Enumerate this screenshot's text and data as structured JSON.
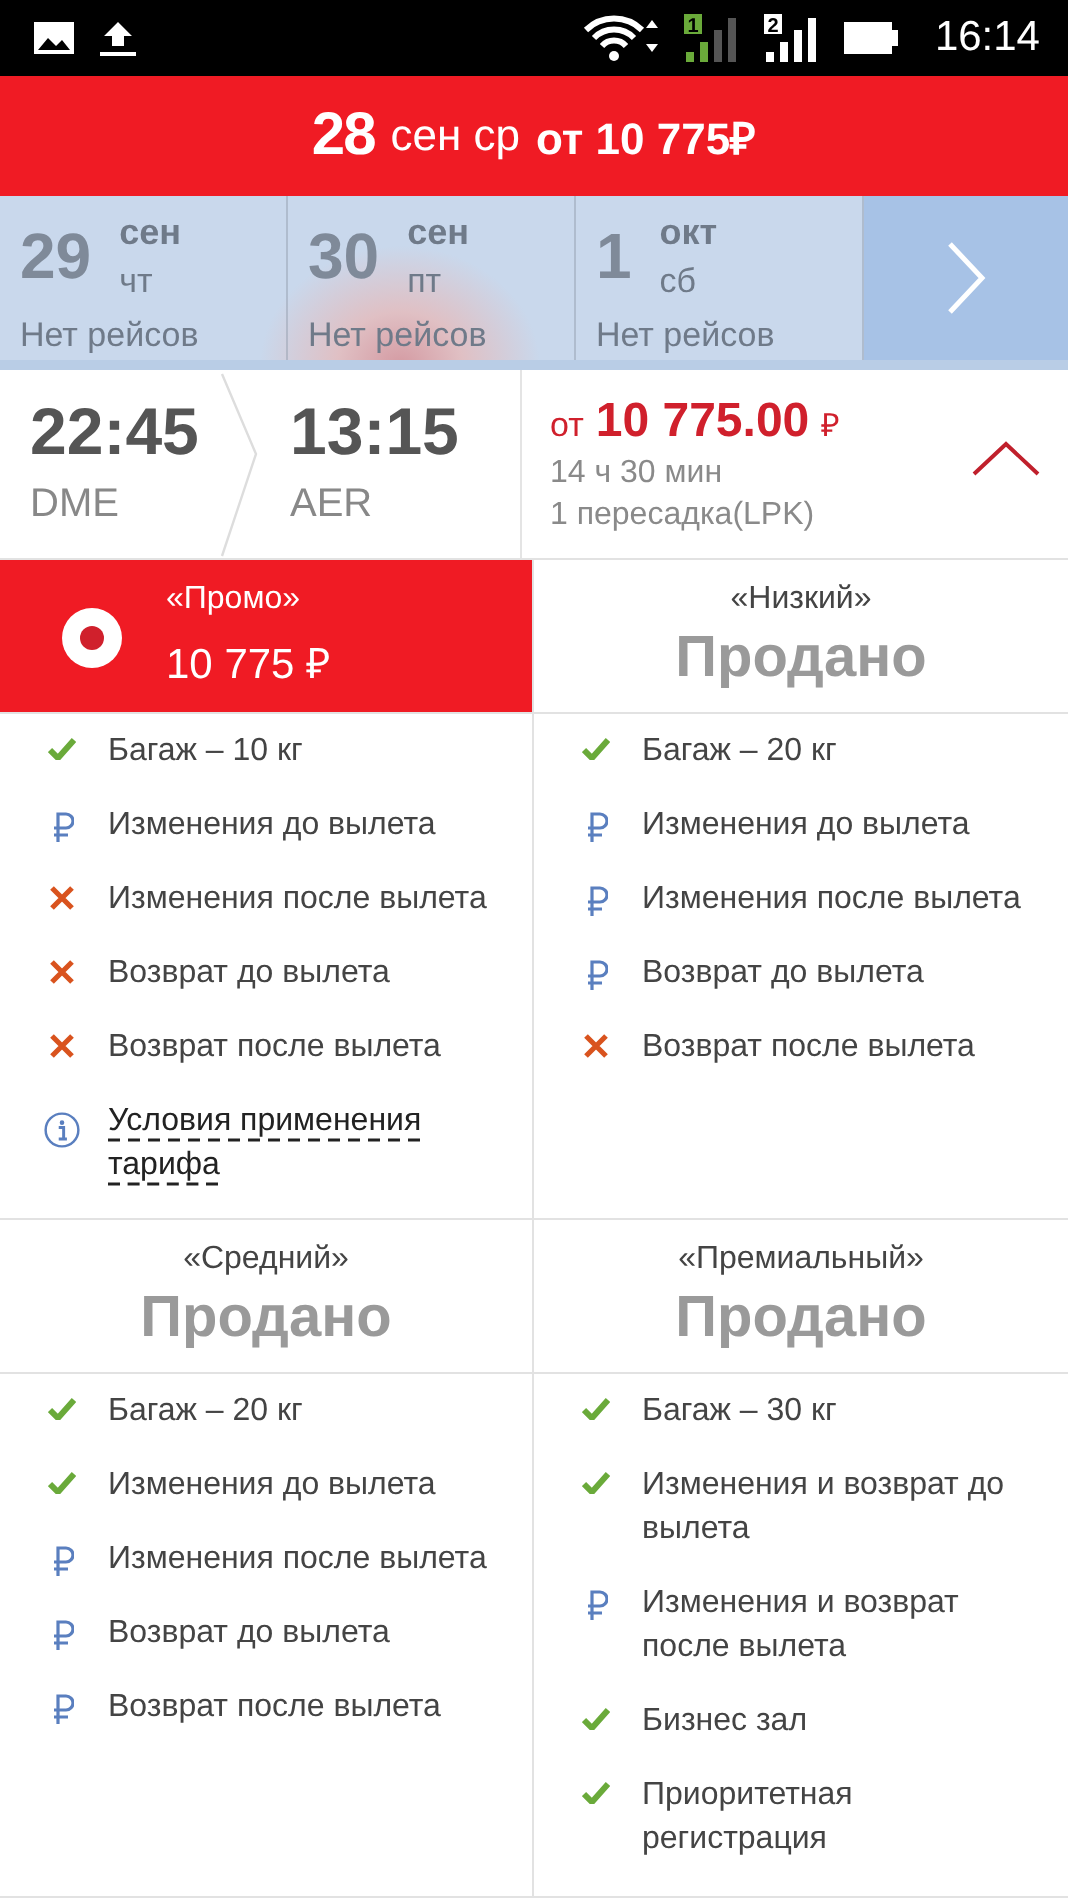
{
  "status_bar": {
    "time": "16:14",
    "sims": [
      {
        "label": "1"
      },
      {
        "label": "2"
      }
    ]
  },
  "header": {
    "day": "28",
    "month_weekday": "сен ср",
    "price": "от 10 775₽"
  },
  "dates": [
    {
      "day": "29",
      "month": "сен",
      "weekday": "чт",
      "note": "Нет рейсов"
    },
    {
      "day": "30",
      "month": "сен",
      "weekday": "пт",
      "note": "Нет рейсов"
    },
    {
      "day": "1",
      "month": "окт",
      "weekday": "сб",
      "note": "Нет рейсов"
    }
  ],
  "flight": {
    "departure_time": "22:45",
    "departure_airport": "DME",
    "arrival_time": "13:15",
    "arrival_airport": "AER",
    "price_prefix": "от",
    "price": "10 775.00",
    "currency": "₽",
    "duration": "14 ч 30 мин",
    "stops": "1 пересадка(LPK)",
    "expanded": true
  },
  "fares": [
    {
      "name": "«Промо»",
      "price": "10 775 ₽",
      "sold": false,
      "selected": true,
      "features": [
        {
          "kind": "check",
          "text": "Багаж – 10 кг"
        },
        {
          "kind": "fee",
          "text": "Изменения до вылета"
        },
        {
          "kind": "cross",
          "text": "Изменения после вылета"
        },
        {
          "kind": "cross",
          "text": "Возврат до вылета"
        },
        {
          "kind": "cross",
          "text": "Возврат после вылета"
        },
        {
          "kind": "info",
          "text": "Условия применения тарифа"
        }
      ]
    },
    {
      "name": "«Низкий»",
      "sold": true,
      "sold_label": "Продано",
      "selected": false,
      "features": [
        {
          "kind": "check",
          "text": "Багаж – 20 кг"
        },
        {
          "kind": "fee",
          "text": "Изменения до вылета"
        },
        {
          "kind": "fee",
          "text": "Изменения после вылета"
        },
        {
          "kind": "fee",
          "text": "Возврат до вылета"
        },
        {
          "kind": "cross",
          "text": "Возврат после вылета"
        }
      ]
    },
    {
      "name": "«Средний»",
      "sold": true,
      "sold_label": "Продано",
      "selected": false,
      "features": [
        {
          "kind": "check",
          "text": "Багаж – 20 кг"
        },
        {
          "kind": "check",
          "text": "Изменения до вылета"
        },
        {
          "kind": "fee",
          "text": "Изменения после вылета"
        },
        {
          "kind": "fee",
          "text": "Возврат до вылета"
        },
        {
          "kind": "fee",
          "text": "Возврат после вылета"
        }
      ]
    },
    {
      "name": "«Премиальный»",
      "sold": true,
      "sold_label": "Продано",
      "selected": false,
      "features": [
        {
          "kind": "check",
          "text": "Багаж – 30 кг"
        },
        {
          "kind": "check",
          "text": "Изменения и возврат до вылета"
        },
        {
          "kind": "fee",
          "text": "Изменения и возврат после вылета"
        },
        {
          "kind": "check",
          "text": "Бизнес зал"
        },
        {
          "kind": "check",
          "text": "Приоритетная регистрация"
        }
      ]
    }
  ]
}
